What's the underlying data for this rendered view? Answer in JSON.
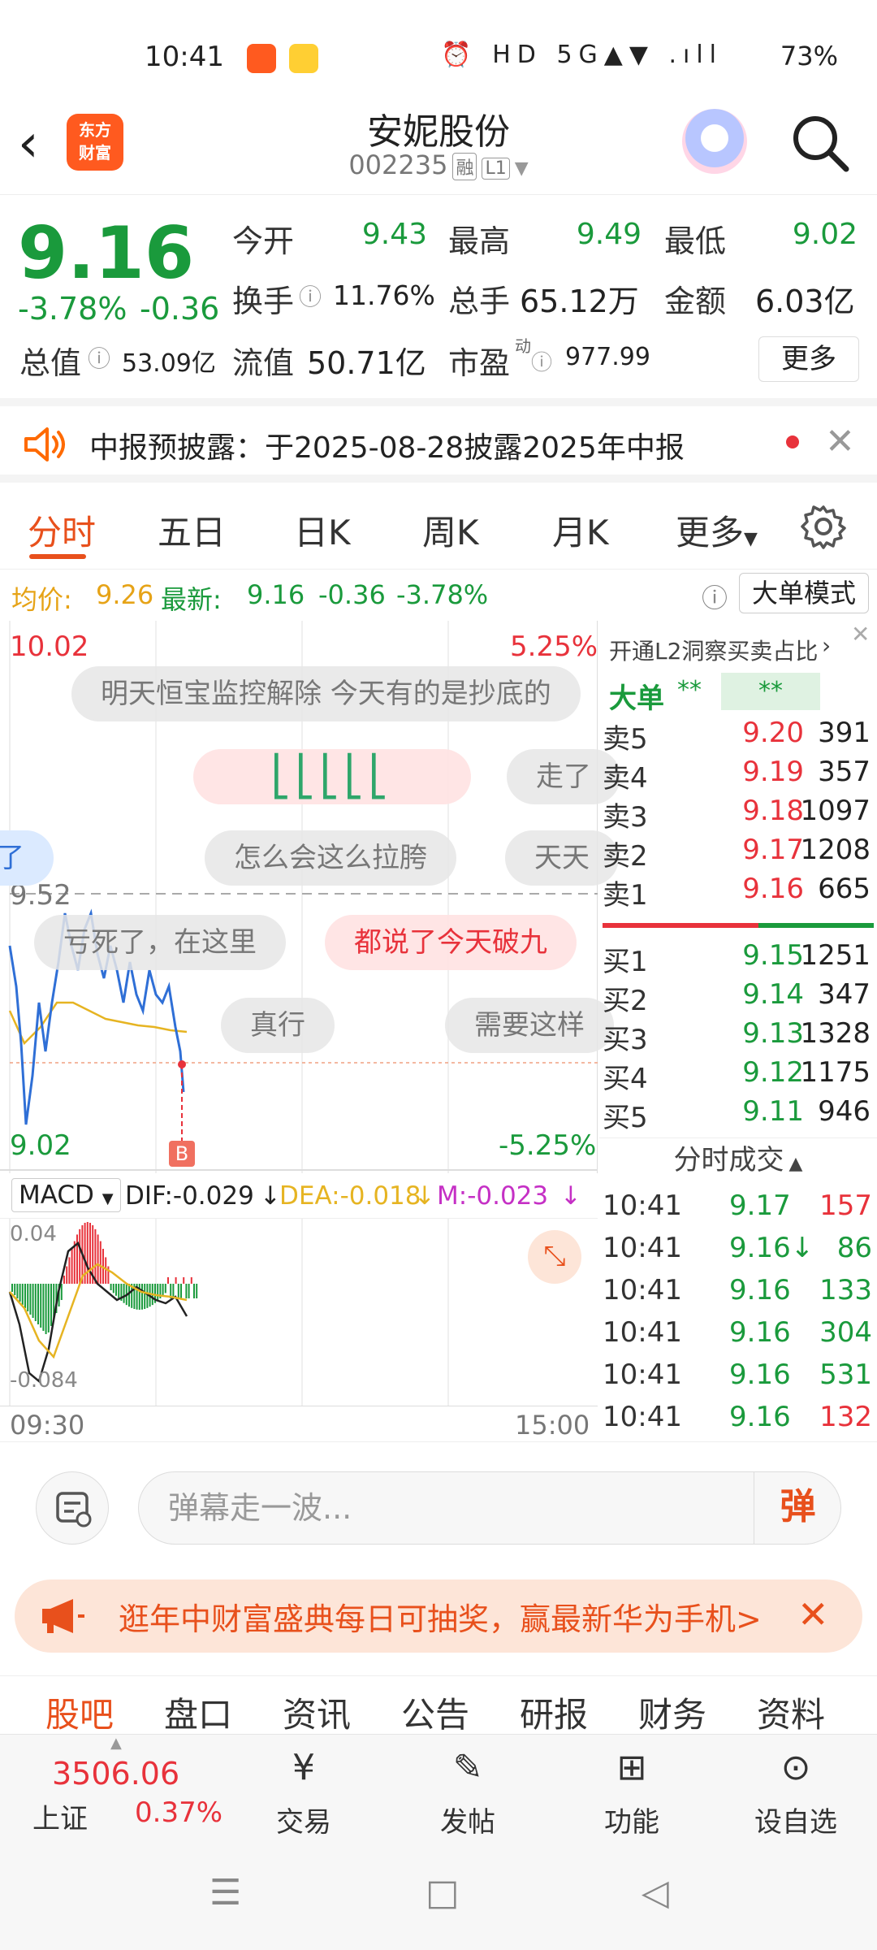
{
  "status": {
    "time": "10:41",
    "battery": "73%",
    "icons": "⏰ HD 5G▲▼ .ıll"
  },
  "header": {
    "back": "‹",
    "logo_line1": "东方",
    "logo_line2": "财富",
    "title": "安妮股份",
    "code": "002235",
    "tag1": "融",
    "tag2": "L1"
  },
  "quote": {
    "price": "9.16",
    "change_pct": "-3.78%",
    "change": "-0.36",
    "open_label": "今开",
    "open": "9.43",
    "high_label": "最高",
    "high": "9.49",
    "low_label": "最低",
    "low": "9.02",
    "turnover_label": "换手",
    "turnover": "11.76%",
    "volume_label": "总手",
    "volume": "65.12万",
    "amount_label": "金额",
    "amount": "6.03亿",
    "mktcap_label": "总值",
    "mktcap": "53.09亿",
    "float_label": "流值",
    "float": "50.71亿",
    "pe_label": "市盈",
    "pe_sup": "动",
    "pe": "977.99",
    "more": "更多"
  },
  "notice": {
    "text": "中报预披露：于2025-08-28披露2025年中报"
  },
  "tabs": [
    "分时",
    "五日",
    "日K",
    "周K",
    "月K",
    "更多"
  ],
  "inforow": {
    "avg_label": "均价:",
    "avg": "9.26",
    "latest_label": "最新:",
    "latest": "9.16",
    "chg": "-0.36",
    "pct": "-3.78%",
    "mode": "大单模式"
  },
  "chart": {
    "top_price": "10.02",
    "top_pct": "5.25%",
    "mid_price": "9.52",
    "bottom_price": "9.02",
    "bottom_pct": "-5.25%",
    "start_time": "09:30",
    "end_time": "15:00",
    "buy_marker": "B",
    "danmu": [
      "明天恒宝监控解除  今天有的是抄底的",
      "走了",
      "怎么会这么拉胯",
      "天天",
      "了",
      "亏死了，在这里",
      "都说了今天破九",
      "真行",
      "需要这样"
    ]
  },
  "macd": {
    "label": "MACD",
    "dif": "DIF:-0.029",
    "dea": "DEA:-0.018",
    "m": "M:-0.023",
    "top": "0.04",
    "bottom": "-0.084"
  },
  "book": {
    "promo": "开通L2洞察买卖占比",
    "big_label": "大单",
    "big_val1": "**",
    "big_val2": "**",
    "asks": [
      {
        "label": "卖5",
        "price": "9.20",
        "vol": "391"
      },
      {
        "label": "卖4",
        "price": "9.19",
        "vol": "357"
      },
      {
        "label": "卖3",
        "price": "9.18",
        "vol": "1097"
      },
      {
        "label": "卖2",
        "price": "9.17",
        "vol": "1208"
      },
      {
        "label": "卖1",
        "price": "9.16",
        "vol": "665"
      }
    ],
    "bids": [
      {
        "label": "买1",
        "price": "9.15",
        "vol": "1251"
      },
      {
        "label": "买2",
        "price": "9.14",
        "vol": "347"
      },
      {
        "label": "买3",
        "price": "9.13",
        "vol": "1328"
      },
      {
        "label": "买4",
        "price": "9.12",
        "vol": "1175"
      },
      {
        "label": "买5",
        "price": "9.11",
        "vol": "946"
      }
    ],
    "trades_title": "分时成交",
    "trades": [
      {
        "time": "10:41",
        "price": "9.17",
        "vol": "157",
        "dir": "red"
      },
      {
        "time": "10:41",
        "price": "9.16↓",
        "vol": "86",
        "dir": "green"
      },
      {
        "time": "10:41",
        "price": "9.16",
        "vol": "133",
        "dir": "green"
      },
      {
        "time": "10:41",
        "price": "9.16",
        "vol": "304",
        "dir": "green"
      },
      {
        "time": "10:41",
        "price": "9.16",
        "vol": "531",
        "dir": "green"
      },
      {
        "time": "10:41",
        "price": "9.16",
        "vol": "132",
        "dir": "red"
      }
    ]
  },
  "comment": {
    "placeholder": "弹幕走一波...",
    "send": "弹"
  },
  "promo": {
    "text": "逛年中财富盛典每日可抽奖，赢最新华为手机>"
  },
  "bottom_tabs": [
    "股吧",
    "盘口",
    "资讯",
    "公告",
    "研报",
    "财务",
    "资料"
  ],
  "toolbar": {
    "index_value": "3506.06",
    "index_name": "上证",
    "index_pct": "0.37%",
    "trade": "交易",
    "post": "发帖",
    "func": "功能",
    "fav": "设自选"
  },
  "colors": {
    "up": "#e8323b",
    "down": "#1a9a3c",
    "accent": "#e8501c"
  }
}
